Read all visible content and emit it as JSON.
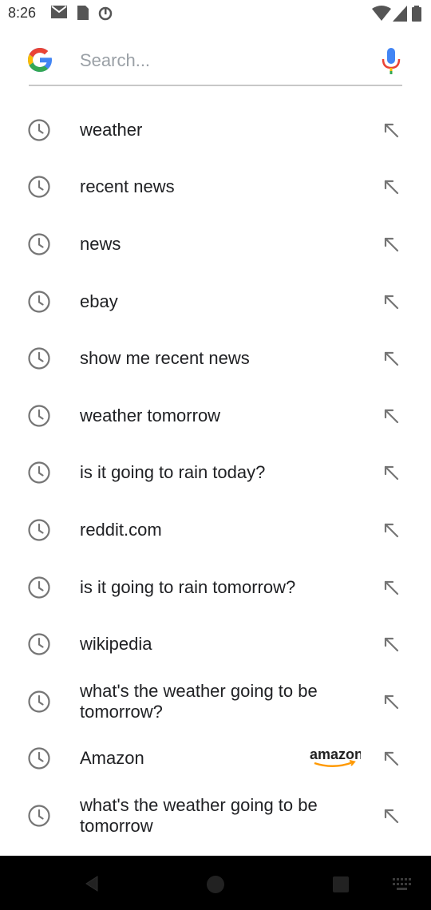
{
  "status_bar": {
    "time": "8:26",
    "left_icons": [
      "gmail-icon",
      "sd-card-icon",
      "sync-icon"
    ],
    "right_icons": [
      "wifi-icon",
      "signal-icon",
      "battery-icon"
    ]
  },
  "search": {
    "placeholder": "Search...",
    "value": "",
    "logo": "google-g-logo",
    "mic": "microphone-icon"
  },
  "suggestions": [
    {
      "text": "weather",
      "icon": "history-clock-icon",
      "action": "fill-arrow-icon"
    },
    {
      "text": "recent news",
      "icon": "history-clock-icon",
      "action": "fill-arrow-icon"
    },
    {
      "text": "news",
      "icon": "history-clock-icon",
      "action": "fill-arrow-icon"
    },
    {
      "text": "ebay",
      "icon": "history-clock-icon",
      "action": "fill-arrow-icon"
    },
    {
      "text": "show me recent news",
      "icon": "history-clock-icon",
      "action": "fill-arrow-icon"
    },
    {
      "text": "weather tomorrow",
      "icon": "history-clock-icon",
      "action": "fill-arrow-icon"
    },
    {
      "text": "is it going to rain today?",
      "icon": "history-clock-icon",
      "action": "fill-arrow-icon"
    },
    {
      "text": "reddit.com",
      "icon": "history-clock-icon",
      "action": "fill-arrow-icon"
    },
    {
      "text": "is it going to rain tomorrow?",
      "icon": "history-clock-icon",
      "action": "fill-arrow-icon"
    },
    {
      "text": "wikipedia",
      "icon": "history-clock-icon",
      "action": "fill-arrow-icon"
    },
    {
      "text": "what's the weather going to be tomorrow?",
      "icon": "history-clock-icon",
      "action": "fill-arrow-icon"
    },
    {
      "text": "Amazon",
      "icon": "history-clock-icon",
      "action": "fill-arrow-icon",
      "brand_logo": "amazon"
    },
    {
      "text": "what's the weather going to be tomorrow",
      "icon": "history-clock-icon",
      "action": "fill-arrow-icon"
    }
  ],
  "nav_bar": {
    "buttons": [
      "back-icon",
      "home-icon",
      "recents-icon",
      "keyboard-icon"
    ]
  },
  "colors": {
    "google_blue": "#4285F4",
    "google_red": "#EA4335",
    "google_yellow": "#FBBC05",
    "google_green": "#34A853",
    "icon_gray": "#757575",
    "nav_bar": "#000000"
  }
}
